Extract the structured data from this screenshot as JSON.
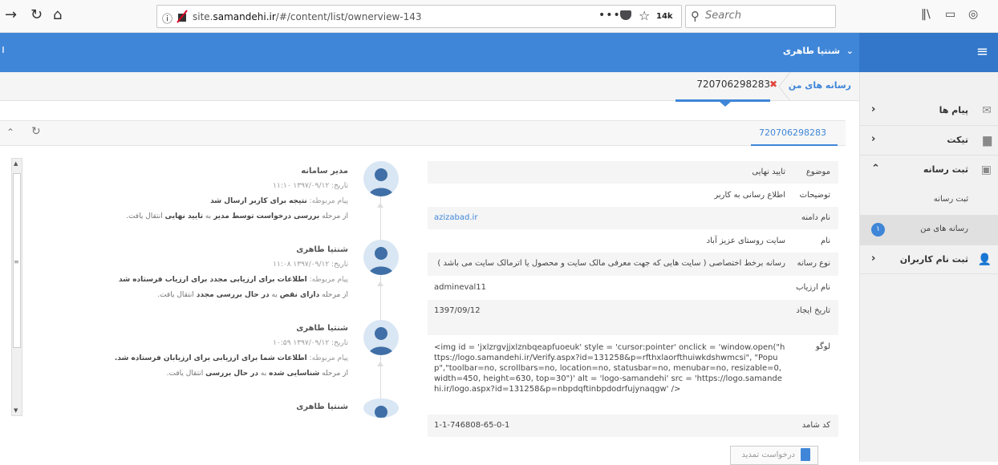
{
  "browser": {
    "url_prefix": "site.",
    "url_domain": "samandehi.ir",
    "url_path": "/#/content/list/ownerview-143",
    "search_placeholder": "Search",
    "pocket_count": "14k",
    "icons": [
      "back-icon",
      "reload-icon",
      "home-icon",
      "info-icon",
      "blocked-content-icon",
      "more-icon",
      "pocket-icon",
      "bookmark-star-icon",
      "library-icon",
      "sidebar-icon",
      "profile-icon"
    ]
  },
  "header": {
    "user_name": "شنتیا طاهری",
    "user_caret": "⌄"
  },
  "sidebar": {
    "items": [
      {
        "label": "پیام ها",
        "icon": "envelope-icon"
      },
      {
        "label": "تیکت",
        "icon": "chat-icon"
      },
      {
        "label": "ثبت رسانه",
        "icon": "document-add-icon"
      },
      {
        "label": "ثبت نام کاربران",
        "icon": "user-add-icon"
      }
    ],
    "sub_items": [
      {
        "label": "ثبت رسانه"
      },
      {
        "label": "رسانه های من",
        "badge": "۱"
      }
    ]
  },
  "breadcrumb": {
    "root": "رسانه های من",
    "tab": "720706298283"
  },
  "panel": {
    "tab": "720706298283"
  },
  "details": [
    {
      "key": "موضوع",
      "value": "تایید نهایی"
    },
    {
      "key": "توضیحات",
      "value": "اطلاع رسانی به کاربر"
    },
    {
      "key": "نام دامنه",
      "value": "azizabad.ir"
    },
    {
      "key": "نام",
      "value": "سایت روستای عزیز آباد"
    },
    {
      "key": "نوع رسانه",
      "value": "رسانه برخط اختصاصی ( سایت هایی که جهت معرفی مالک سایت و محصول یا اترمالک سایت می باشد )"
    },
    {
      "key": "نام ارزیاب",
      "value": "admineval11"
    },
    {
      "key": "تاریخ ایجاد",
      "value": "1397/09/12"
    },
    {
      "key": "لوگو",
      "value": "<img id = 'jxlzrgvjjxlznbqeapfuoeuk' style = 'cursor:pointer' onclick = 'window.open(\"https://logo.samandehi.ir/Verify.aspx?id=131258&p=rfthxlaorfthuiwkdshwmcsi\", \"Popup\",\"toolbar=no, scrollbars=no, location=no, statusbar=no, menubar=no, resizable=0, width=450, height=630, top=30\")' alt = 'logo-samandehi' src = 'https://logo.samandehi.ir/logo.aspx?id=131258&p=nbpdqftinbpdodrfujynaqgw' />"
    },
    {
      "key": "کد شامد",
      "value": "1-1-746808-65-0-1"
    }
  ],
  "timeline": [
    {
      "who": "مدیر سامانه",
      "date_label": "تاریخ:",
      "date": "۱۳۹۷/۰۹/۱۲ ۱۱:۱۰",
      "msg_label": "پیام مربوطه:",
      "msg": "نتیجه برای کاربر ارسال شد",
      "from_label": "از مرحله",
      "from": "بررسی درخواست توسط مدیر",
      "to_label": "به",
      "to": "تایید نهایی",
      "end": "انتقال یافت."
    },
    {
      "who": "شنتیا طاهری",
      "date_label": "تاریخ:",
      "date": "۱۳۹۷/۰۹/۱۲ ۱۱:۰۸",
      "msg_label": "پیام مربوطه:",
      "msg": "اطلاعات برای ارزیابی مجدد برای ارزیاب فرستاده شد",
      "from_label": "از مرحله",
      "from": "دارای نقص",
      "to_label": "به",
      "to": "در حال بررسی مجدد",
      "end": "انتقال یافت."
    },
    {
      "who": "شنتیا طاهری",
      "date_label": "تاریخ:",
      "date": "۱۳۹۷/۰۹/۱۲ ۱۰:۵۹",
      "msg_label": "پیام مربوطه:",
      "msg": "اطلاعات شما برای ارزیابی برای ارزیابان فرستاده شد.",
      "from_label": "از مرحله",
      "from": "شناسایی شده",
      "to_label": "به",
      "to": "در حال بررسی",
      "end": "انتقال یافت."
    },
    {
      "who": "شنتیا طاهری"
    }
  ],
  "renew_button": "درخواست تمدید",
  "colors": {
    "primary": "#3f86d8",
    "close": "#e0463d"
  }
}
